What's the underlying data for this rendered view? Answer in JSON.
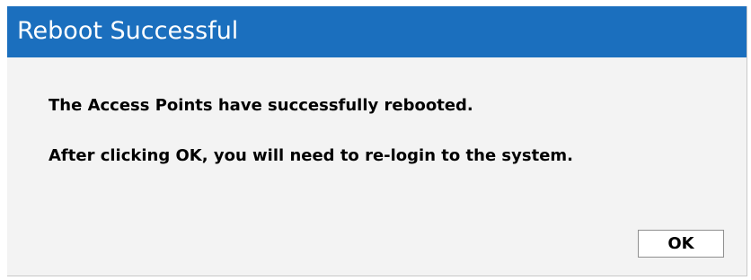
{
  "dialog": {
    "title": "Reboot Successful",
    "messages": [
      "The Access Points have successfully rebooted.",
      "After clicking OK, you will need to re-login to the system."
    ],
    "ok_label": "OK"
  },
  "colors": {
    "title_bar": "#1b6fbe",
    "dialog_background": "#f3f3f3",
    "title_text": "#ffffff"
  }
}
